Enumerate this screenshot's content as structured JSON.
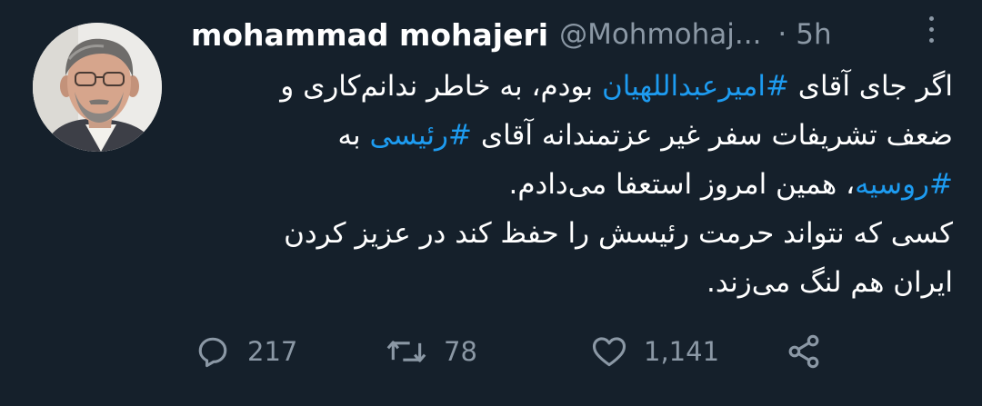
{
  "tweet": {
    "display_name": "mohammad mohajeri",
    "handle": "@Mohmohaj...",
    "separator": "·",
    "time": "5h",
    "body": {
      "line1_a": "اگر جای آقای ",
      "line1_hashtag": "#امیرعبداللهیان",
      "line1_b": " بودم، به خاطر ندانم‌کاری و",
      "line2_a": "ضعف تشریفات سفر غیر عزتمندانه آقای ",
      "line2_hashtag": "#رئیسی",
      "line2_b": " به",
      "line3_hashtag": "#روسیه",
      "line3_b": "، همین امروز استعفا می‌دادم.",
      "line4": "کسی که نتواند حرمت رئیسش را حفظ کند در عزیز کردن",
      "line5": "ایران هم لنگ می‌زند."
    },
    "actions": {
      "replies": "217",
      "retweets": "78",
      "likes": "1,141"
    }
  },
  "colors": {
    "background": "#15202b",
    "text": "#ffffff",
    "muted": "#8b98a5",
    "hashtag": "#1d9bf0"
  },
  "icons": [
    "reply-icon",
    "retweet-icon",
    "like-icon",
    "share-icon",
    "more-icon"
  ]
}
